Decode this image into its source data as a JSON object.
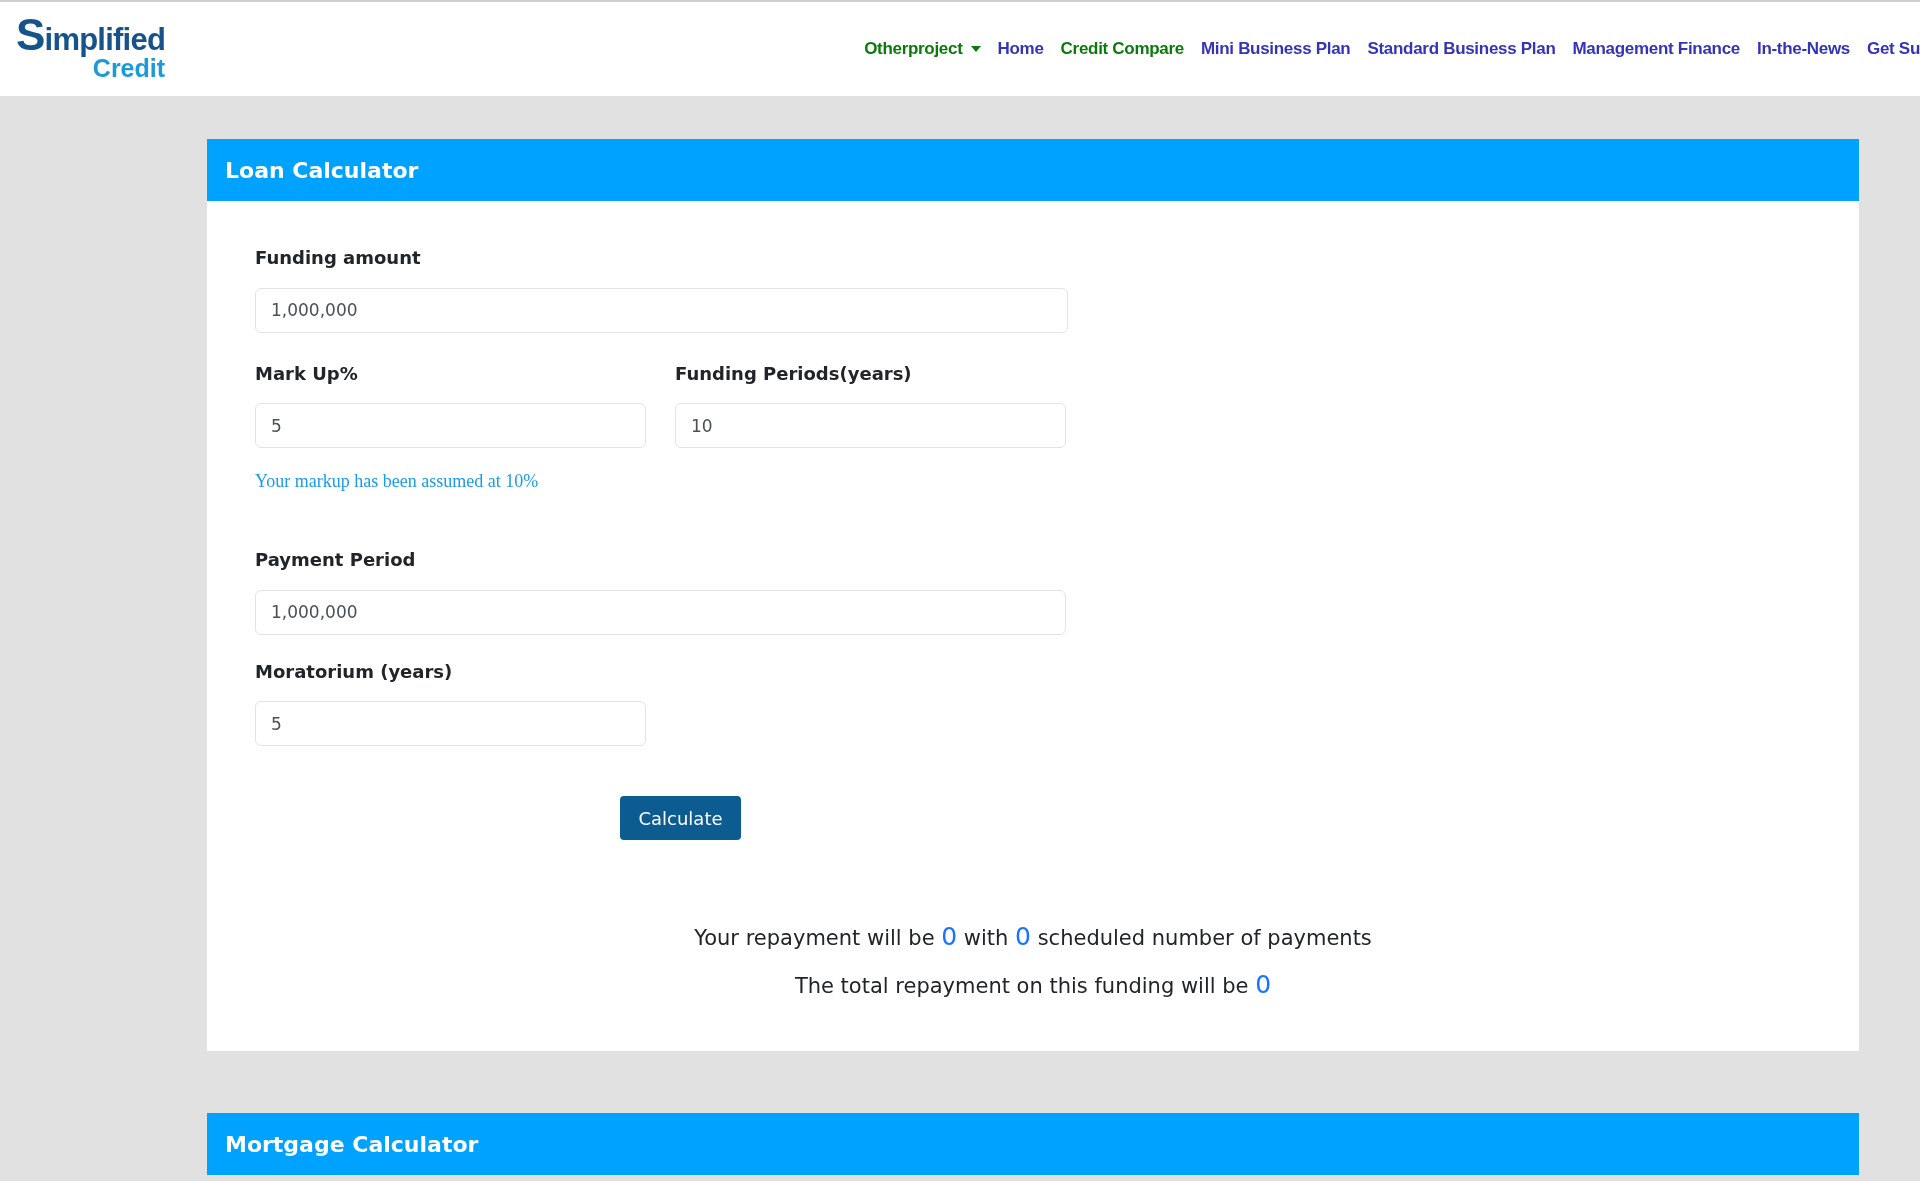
{
  "logo": {
    "line1": "Simplified",
    "line2": "Credit"
  },
  "nav": [
    {
      "label": "Otherproject",
      "color": "#0b7a0b",
      "dropdown": true
    },
    {
      "label": "Home",
      "color": "#3434b8",
      "dropdown": false
    },
    {
      "label": "Credit Compare",
      "color": "#0b7a0b",
      "dropdown": false
    },
    {
      "label": "Mini Business Plan",
      "color": "#3434b8",
      "dropdown": false
    },
    {
      "label": "Standard Business Plan",
      "color": "#3434b8",
      "dropdown": false
    },
    {
      "label": "Management Finance",
      "color": "#3434b8",
      "dropdown": false
    },
    {
      "label": "In-the-News",
      "color": "#3434b8",
      "dropdown": false
    },
    {
      "label": "Get Su",
      "color": "#3434b8",
      "dropdown": false
    }
  ],
  "loan_calculator": {
    "title": "Loan Calculator",
    "funding_amount": {
      "label": "Funding amount",
      "value": "1,000,000"
    },
    "mark_up": {
      "label": "Mark Up%",
      "value": "5"
    },
    "funding_periods": {
      "label": "Funding Periods(years)",
      "value": "10"
    },
    "hint": "Your markup has been assumed at 10%",
    "payment_period": {
      "label": "Payment Period",
      "value": "1,000,000"
    },
    "moratorium": {
      "label": "Moratorium (years)",
      "value": "5"
    },
    "button": "Calculate",
    "results": [
      [
        {
          "kind": "text",
          "text": "Your repayment will be "
        },
        {
          "kind": "value",
          "text": "0"
        },
        {
          "kind": "text",
          "text": " with "
        },
        {
          "kind": "value",
          "text": "0"
        },
        {
          "kind": "text",
          "text": " scheduled number of payments"
        }
      ],
      [
        {
          "kind": "text",
          "text": "The total repayment on this funding will be "
        },
        {
          "kind": "value",
          "text": "0"
        }
      ]
    ]
  },
  "mortgage_calculator": {
    "title": "Mortgage Calculator"
  }
}
